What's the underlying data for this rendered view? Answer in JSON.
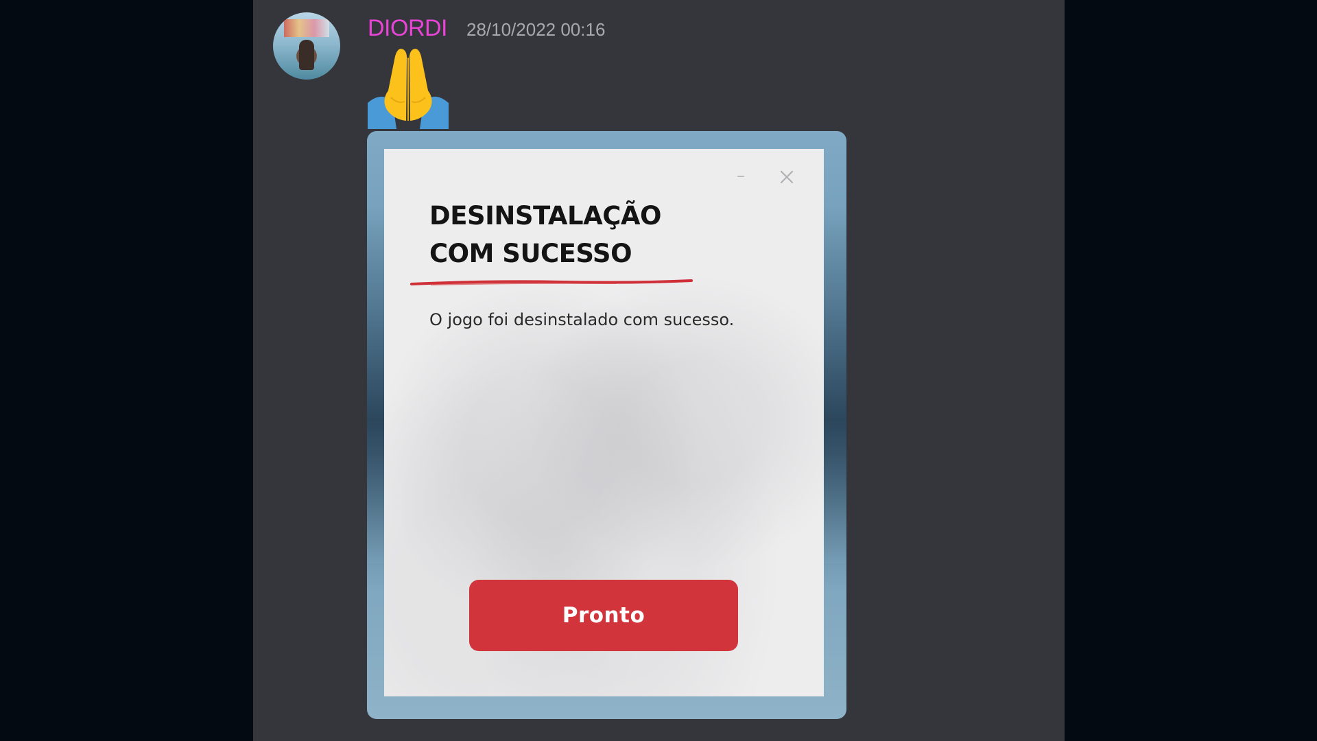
{
  "message": {
    "author": "DIORDI",
    "timestamp": "28/10/2022 00:16",
    "author_color": "#e844d6",
    "emoji_icon": "folded-hands-icon"
  },
  "dialog": {
    "title_line1": "DESINSTALAÇÃO",
    "title_line2": "COM SUCESSO",
    "body": "O jogo foi desinstalado com sucesso.",
    "button_label": "Pronto",
    "button_color": "#d1353b",
    "minimize_icon": "minimize-icon",
    "close_icon": "close-icon"
  }
}
